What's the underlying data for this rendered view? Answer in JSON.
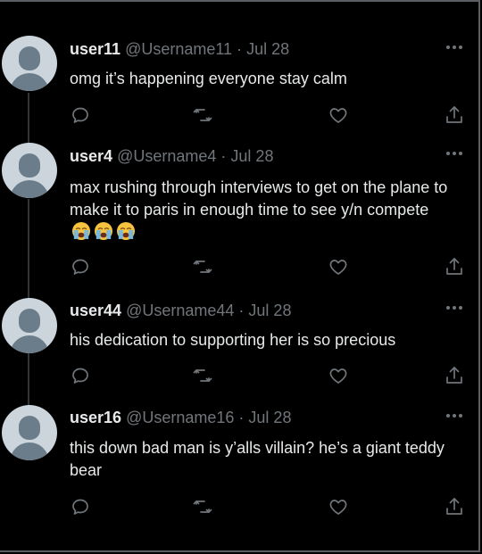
{
  "tweets": [
    {
      "username": "user11",
      "handle": "@Username11",
      "separator": "·",
      "date": "Jul 28",
      "text": "omg it’s happening everyone stay calm",
      "emojis": []
    },
    {
      "username": "user4",
      "handle": "@Username4",
      "separator": "·",
      "date": "Jul 28",
      "text": "max rushing through interviews to get on the plane to make it to paris in enough time to see y/n compete",
      "emojis": [
        "loudly-crying-face",
        "loudly-crying-face",
        "loudly-crying-face"
      ]
    },
    {
      "username": "user44",
      "handle": "@Username44",
      "separator": "·",
      "date": "Jul 28",
      "text": "his dedication to supporting her is so precious",
      "emojis": []
    },
    {
      "username": "user16",
      "handle": "@Username16",
      "separator": "·",
      "date": "Jul 28",
      "text": "this down bad man is y’alls villain? he’s a giant teddy bear",
      "emojis": []
    }
  ],
  "icons": {
    "reply": "reply-icon",
    "retweet": "retweet-icon",
    "like": "like-icon",
    "share": "share-icon",
    "more": "more-icon"
  },
  "colors": {
    "background": "#000000",
    "text": "#e7e9ea",
    "muted": "#71767b",
    "avatar_bg": "#cdd5dc",
    "avatar_fg": "#6b7d8a",
    "thread_line": "#333639"
  }
}
